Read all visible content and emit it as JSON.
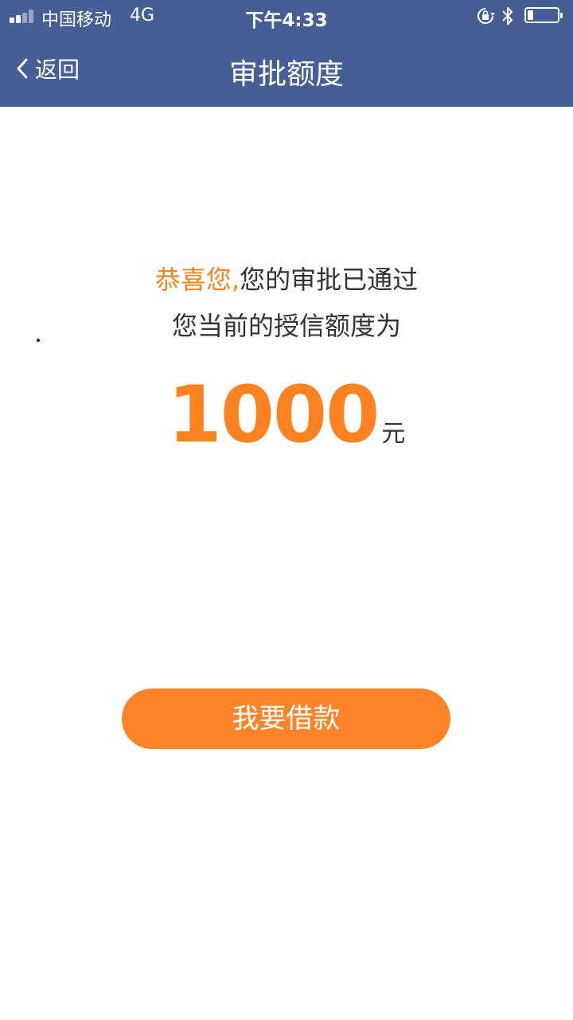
{
  "status_bar": {
    "carrier": "中国移动",
    "network": "4G",
    "time": "下午4:33",
    "battery_level": 0.2
  },
  "nav": {
    "back_label": "返回",
    "title": "审批额度"
  },
  "message": {
    "congrats": "恭喜您,",
    "approved": "您的审批已通过",
    "credit_line_label": "您当前的授信额度为"
  },
  "credit": {
    "amount": "1000",
    "unit": "元"
  },
  "actions": {
    "borrow_label": "我要借款"
  },
  "colors": {
    "header_bg": "#455e95",
    "accent": "#ff8220",
    "button_bg": "#ff8429",
    "text": "#333333"
  },
  "icons": [
    "signal-icon",
    "orientation-lock-icon",
    "bluetooth-icon",
    "battery-icon",
    "chevron-left-icon"
  ]
}
